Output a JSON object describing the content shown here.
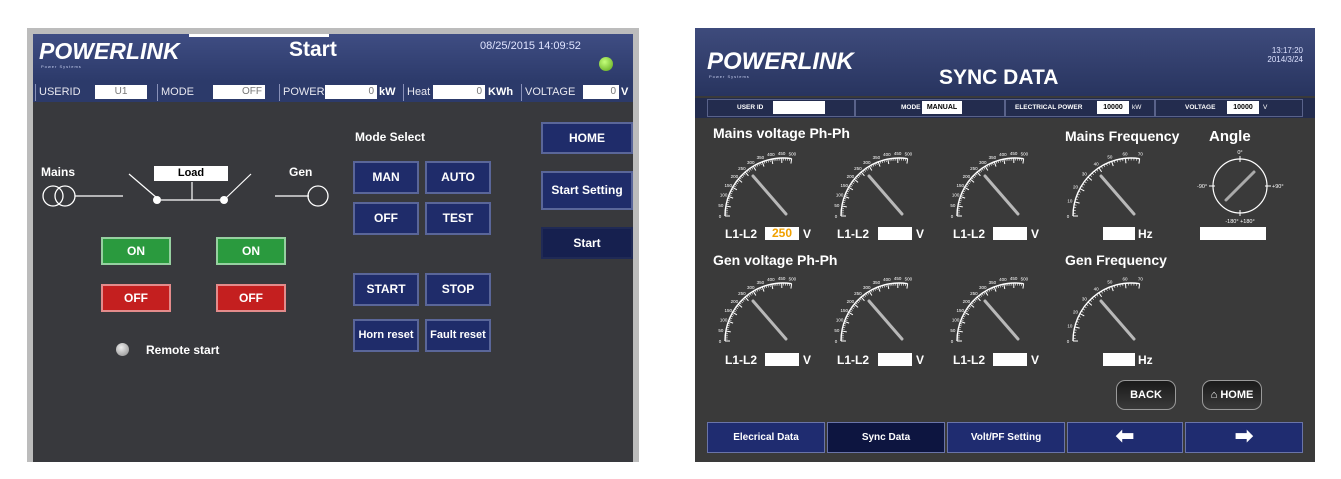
{
  "start_screen": {
    "logo": "POWERLINK",
    "logo_sub": "Power Systems",
    "title": "Start",
    "datetime": "08/25/2015 14:09:52",
    "status_bar": {
      "userid_label": "USERID",
      "userid_value": "U1",
      "mode_label": "MODE",
      "mode_value": "OFF",
      "power_label": "POWER",
      "power_value": "0",
      "power_unit": "kW",
      "heat_label": "Heat",
      "heat_value": "0",
      "heat_unit": "KWh",
      "voltage_label": "VOLTAGE",
      "voltage_value": "0",
      "voltage_unit": "V"
    },
    "diagram": {
      "mains_label": "Mains",
      "load_label": "Load",
      "gen_label": "Gen"
    },
    "mains_buttons": {
      "on": "ON",
      "off": "OFF"
    },
    "gen_buttons": {
      "on": "ON",
      "off": "OFF"
    },
    "remote_start_label": "Remote start",
    "mode_select": {
      "title": "Mode Select",
      "man": "MAN",
      "auto": "AUTO",
      "off": "OFF",
      "test": "TEST",
      "start": "START",
      "stop": "STOP",
      "horn_reset": "Horn reset",
      "fault_reset": "Fault reset"
    },
    "nav": {
      "home": "HOME",
      "start_setting": "Start Setting",
      "start": "Start"
    },
    "colors": {
      "on_green": "#2a9a3e",
      "off_red": "#c41f1f",
      "status_led": "#7acc2a"
    }
  },
  "sync_screen": {
    "logo": "POWERLINK",
    "logo_sub": "Power Systems",
    "title": "SYNC DATA",
    "time": "13:17:20",
    "date": "2014/3/24",
    "status_bar": {
      "userid_label": "USER ID",
      "userid_value": "",
      "mode_label": "MODE",
      "mode_value": "MANUAL",
      "power_label": "ELECTRICAL POWER",
      "power_value": "10000",
      "power_unit": "kW",
      "voltage_label": "VOLTAGE",
      "voltage_value": "10000",
      "voltage_unit": "V"
    },
    "mains_voltage_title": "Mains voltage Ph-Ph",
    "gen_voltage_title": "Gen voltage Ph-Ph",
    "mains_frequency_title": "Mains Frequency",
    "gen_frequency_title": "Gen Frequency",
    "angle_title": "Angle",
    "voltage_ticks": [
      "0",
      "50",
      "100",
      "150",
      "200",
      "250",
      "300",
      "350",
      "400",
      "450",
      "500"
    ],
    "frequency_ticks": [
      "0",
      "10",
      "20",
      "30",
      "40",
      "50",
      "60",
      "70"
    ],
    "angle_ticks": {
      "top": "0°",
      "left": "-90°",
      "right": "+90°",
      "bottom": "-180° +180°"
    },
    "gauge_label": "L1-L2",
    "volt_unit": "V",
    "hz_unit": "Hz",
    "mains_voltage_values": [
      "250",
      "",
      ""
    ],
    "gen_voltage_values": [
      "",
      "",
      ""
    ],
    "buttons": {
      "back": "BACK",
      "home": "HOME"
    },
    "bottom_nav": [
      "Elecrical Data",
      "Sync Data",
      "Volt/PF Setting"
    ],
    "colors": {
      "value_orange": "#f0a000"
    }
  }
}
